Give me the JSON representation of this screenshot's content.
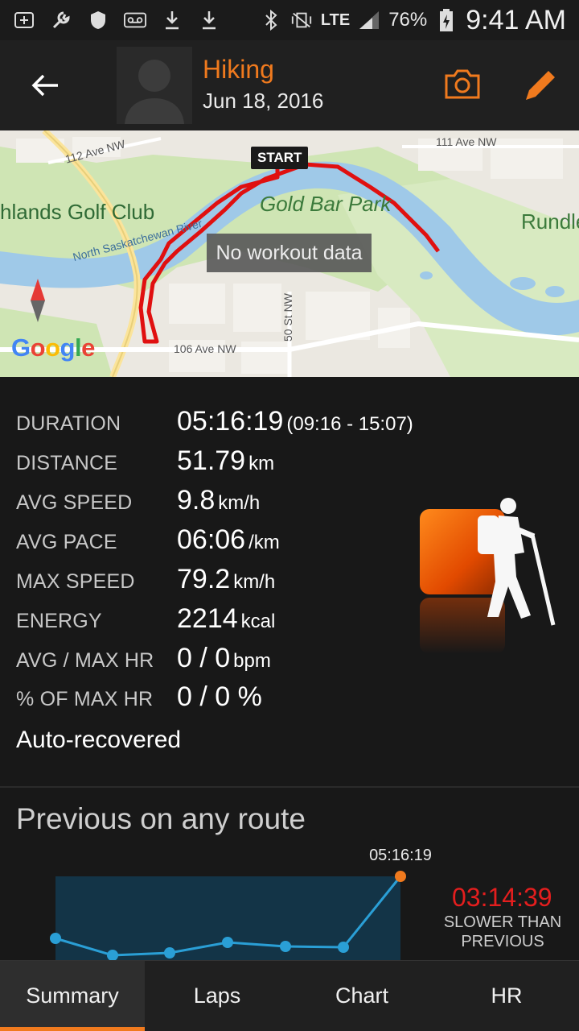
{
  "status_bar": {
    "battery": "76%",
    "network": "LTE",
    "time": "9:41 AM"
  },
  "header": {
    "title": "Hiking",
    "date": "Jun 18, 2016"
  },
  "map": {
    "labels": {
      "street_112": "112 Ave NW",
      "street_111": "111 Ave NW",
      "street_106": "106 Ave NW",
      "street_50": "50 St NW",
      "park": "Gold Bar Park",
      "golf": "hlands Golf Club",
      "river": "North Saskatchewan River",
      "rundle": "Rundle",
      "start": "START",
      "no_data": "No workout data",
      "google": "Google"
    }
  },
  "stats": {
    "duration_label": "DURATION",
    "duration_value": "05:16:19",
    "duration_range": "(09:16 - 15:07)",
    "distance_label": "DISTANCE",
    "distance_value": "51.79",
    "distance_unit": "km",
    "avg_speed_label": "AVG SPEED",
    "avg_speed_value": "9.8",
    "avg_speed_unit": "km/h",
    "avg_pace_label": "AVG PACE",
    "avg_pace_value": "06:06",
    "avg_pace_unit": "/km",
    "max_speed_label": "MAX SPEED",
    "max_speed_value": "79.2",
    "max_speed_unit": "km/h",
    "energy_label": "ENERGY",
    "energy_value": "2214",
    "energy_unit": "kcal",
    "hr_label": "AVG / MAX HR",
    "hr_value": "0 / 0",
    "hr_unit": "bpm",
    "pct_hr_label": "% OF MAX HR",
    "pct_hr_value": "0 / 0 %",
    "auto_recovered": "Auto-recovered"
  },
  "previous": {
    "title": "Previous on any route",
    "latest_label": "05:16:19",
    "diff": "03:14:39",
    "diff_desc_line1": "SLOWER THAN",
    "diff_desc_line2": "PREVIOUS"
  },
  "tabs": [
    "Summary",
    "Laps",
    "Chart",
    "HR"
  ],
  "colors": {
    "accent": "#f07a1e",
    "diff": "#e41e1e",
    "chart_line": "#2a9fd6"
  }
}
